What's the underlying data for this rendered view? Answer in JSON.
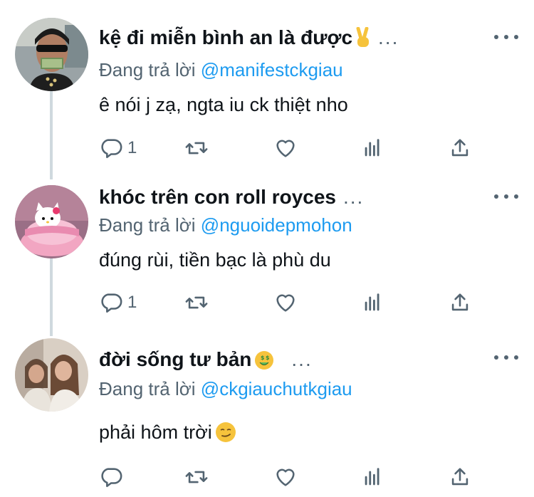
{
  "tweets": [
    {
      "name": "kệ đi miễn bình an là được",
      "name_emoji": "✌️",
      "name_ellipsis": "...",
      "reply_prefix": "Đang trả lời",
      "reply_handle": "@manifestckgiau",
      "text": "ê nói j zạ, ngta iu ck thiệt nho",
      "reply_count": "1",
      "avatar": "avatar-sunglasses-money"
    },
    {
      "name": "khóc trên con roll royces",
      "name_ellipsis": "...",
      "reply_prefix": "Đang trả lời",
      "reply_handle": "@nguoidepmohon",
      "text": "đúng rùi, tiền bạc là phù du",
      "reply_count": "1",
      "avatar": "avatar-hello-kitty-bed"
    },
    {
      "name": "đời sống tư bản",
      "name_emoji": "🤑",
      "name_ellipsis": "...",
      "reply_prefix": "Đang trả lời",
      "reply_handle": "@ckgiauchutkgiau",
      "text": "phải hôm trời",
      "text_emoji": "😏",
      "reply_count": "",
      "avatar": "avatar-two-girls-photo"
    }
  ],
  "colors": {
    "link": "#1d9bf0",
    "secondary": "#536471",
    "text": "#0f1419",
    "thread_line": "#cfd9de"
  },
  "icons": [
    "reply-icon",
    "retweet-icon",
    "like-icon",
    "views-icon",
    "share-icon",
    "more-icon"
  ]
}
